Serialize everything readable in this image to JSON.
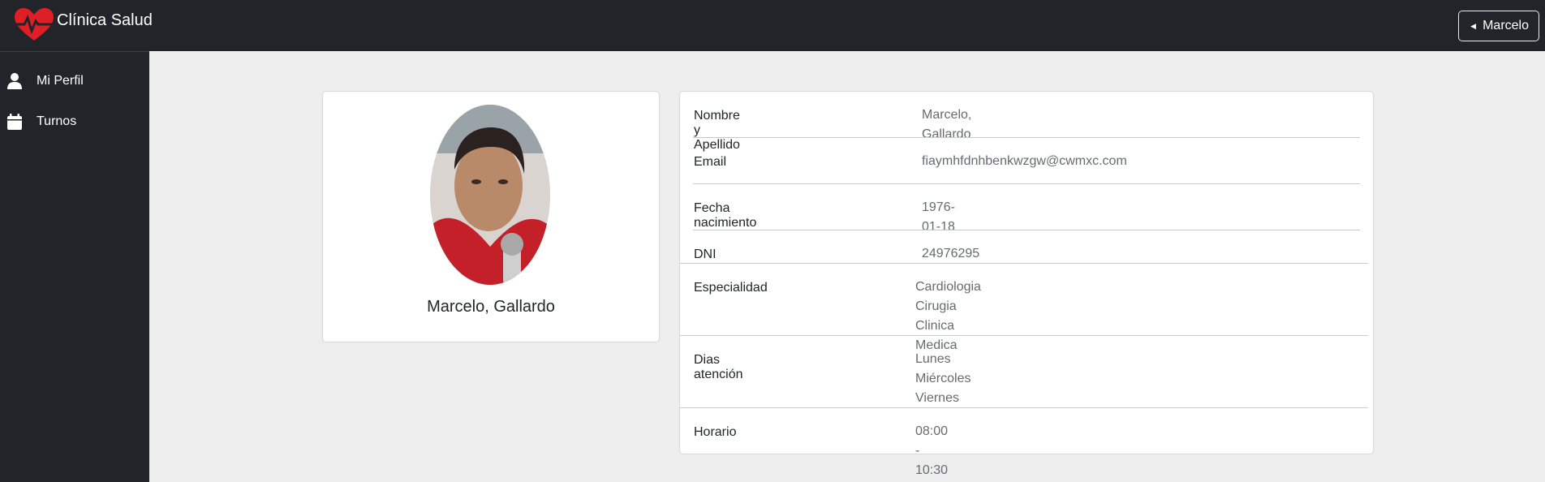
{
  "header": {
    "brand_name": "Clínica Salud",
    "user_button_label": "Marcelo"
  },
  "sidebar": {
    "items": [
      {
        "label": "Mi Perfil",
        "icon": "user-icon"
      },
      {
        "label": "Turnos",
        "icon": "calendar-icon"
      }
    ]
  },
  "profile": {
    "name": "Marcelo, Gallardo"
  },
  "details": {
    "name_label": "Nombre y Apellido",
    "name_value": "Marcelo, Gallardo",
    "email_label": "Email",
    "email_value": "fiaymhfdnhbenkwzgw@cwmxc.com",
    "birth_label": "Fecha nacimiento",
    "birth_value": "1976-01-18",
    "dni_label": "DNI",
    "dni_value": "24976295",
    "specialty_label": "Especialidad",
    "specialties": [
      "Cardiologia",
      "Cirugia",
      "Clinica Medica"
    ],
    "days_label": "Dias atención",
    "days": [
      "Lunes",
      "Miércoles",
      "Viernes"
    ],
    "schedule_label": "Horario",
    "schedule_value": "08:00 - 10:30"
  },
  "colors": {
    "topbar": "#212529",
    "brand_heart": "#e01e25",
    "page_bg": "#ededed"
  }
}
